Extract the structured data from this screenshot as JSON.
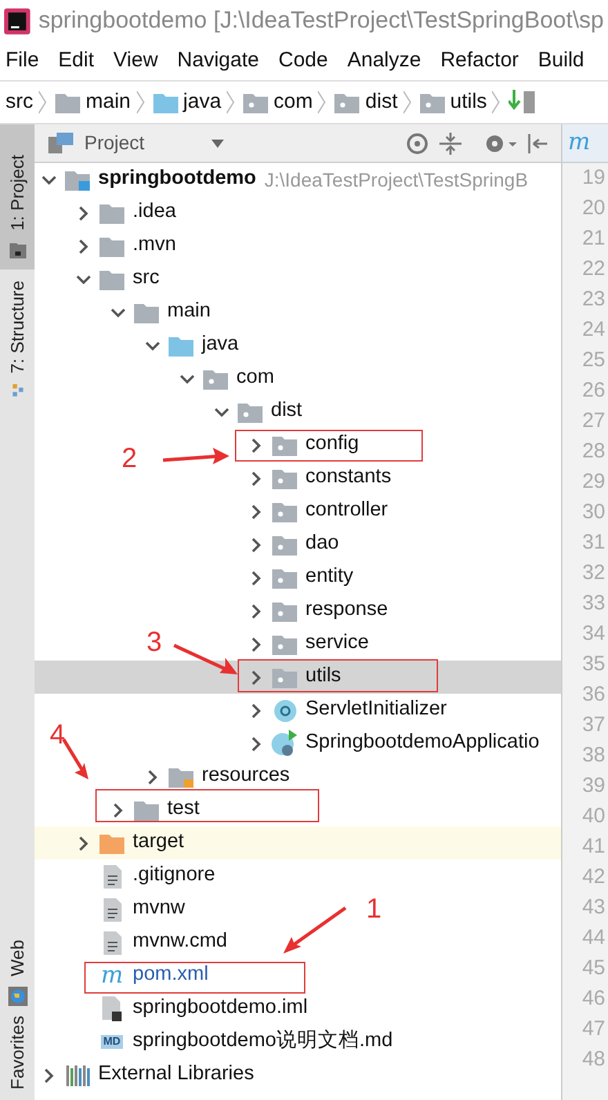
{
  "window": {
    "title": "springbootdemo [J:\\IdeaTestProject\\TestSpringBoot\\sp"
  },
  "menu": [
    "File",
    "Edit",
    "View",
    "Navigate",
    "Code",
    "Analyze",
    "Refactor",
    "Build"
  ],
  "breadcrumb": [
    {
      "label": "src",
      "kind": "plain"
    },
    {
      "label": "main",
      "kind": "folder"
    },
    {
      "label": "java",
      "kind": "source"
    },
    {
      "label": "com",
      "kind": "package"
    },
    {
      "label": "dist",
      "kind": "package"
    },
    {
      "label": "utils",
      "kind": "package"
    }
  ],
  "side_tabs": [
    {
      "label": "1: Project",
      "selected": true,
      "kind": "project"
    },
    {
      "label": "7: Structure",
      "selected": false,
      "kind": "structure"
    },
    {
      "label": "Web",
      "selected": false,
      "kind": "web"
    },
    {
      "label": "Favorites",
      "selected": false,
      "kind": "favorites"
    }
  ],
  "panel": {
    "title": "Project"
  },
  "editor_tab": {
    "icon": "m"
  },
  "tree": [
    {
      "name": "springbootdemo",
      "kind": "module",
      "path": "J:\\IdeaTestProject\\TestSpringB",
      "expanded": true,
      "selected": false,
      "children": [
        {
          "name": ".idea",
          "kind": "folder",
          "expanded": false,
          "selected": false
        },
        {
          "name": ".mvn",
          "kind": "folder",
          "expanded": false,
          "selected": false
        },
        {
          "name": "src",
          "kind": "folder",
          "expanded": true,
          "selected": false,
          "children": [
            {
              "name": "main",
              "kind": "folder",
              "expanded": true,
              "selected": false,
              "children": [
                {
                  "name": "java",
                  "kind": "source",
                  "expanded": true,
                  "selected": false,
                  "children": [
                    {
                      "name": "com",
                      "kind": "package",
                      "expanded": true,
                      "selected": false,
                      "children": [
                        {
                          "name": "dist",
                          "kind": "package",
                          "expanded": true,
                          "selected": false,
                          "children": [
                            {
                              "name": "config",
                              "kind": "package",
                              "expanded": false,
                              "selected": false
                            },
                            {
                              "name": "constants",
                              "kind": "package",
                              "expanded": false,
                              "selected": false
                            },
                            {
                              "name": "controller",
                              "kind": "package",
                              "expanded": false,
                              "selected": false
                            },
                            {
                              "name": "dao",
                              "kind": "package",
                              "expanded": false,
                              "selected": false
                            },
                            {
                              "name": "entity",
                              "kind": "package",
                              "expanded": false,
                              "selected": false
                            },
                            {
                              "name": "response",
                              "kind": "package",
                              "expanded": false,
                              "selected": false
                            },
                            {
                              "name": "service",
                              "kind": "package",
                              "expanded": false,
                              "selected": false
                            },
                            {
                              "name": "utils",
                              "kind": "package",
                              "expanded": false,
                              "selected": true
                            },
                            {
                              "name": "ServletInitializer",
                              "kind": "class",
                              "expanded": false,
                              "selected": false
                            },
                            {
                              "name": "SpringbootdemoApplicatio",
                              "kind": "app",
                              "expanded": false,
                              "selected": false
                            }
                          ]
                        }
                      ]
                    }
                  ]
                },
                {
                  "name": "resources",
                  "kind": "resources",
                  "expanded": false,
                  "selected": false
                }
              ]
            },
            {
              "name": "test",
              "kind": "folder",
              "expanded": false,
              "selected": false
            }
          ]
        },
        {
          "name": "target",
          "kind": "excluded",
          "expanded": false,
          "selected": false
        },
        {
          "name": ".gitignore",
          "kind": "file",
          "selected": false
        },
        {
          "name": "mvnw",
          "kind": "file",
          "selected": false
        },
        {
          "name": "mvnw.cmd",
          "kind": "file",
          "selected": false
        },
        {
          "name": "pom.xml",
          "kind": "maven",
          "icon": "m",
          "selected": false
        },
        {
          "name": "springbootdemo.iml",
          "kind": "iml",
          "selected": false
        },
        {
          "name": "springbootdemo说明文档.md",
          "kind": "md",
          "icon": "MD",
          "selected": false
        }
      ]
    },
    {
      "name": "External Libraries",
      "kind": "libraries",
      "expanded": false,
      "selected": false
    }
  ],
  "gutter": {
    "line_numbers": [
      "19",
      "20",
      "21",
      "22",
      "23",
      "24",
      "25",
      "26",
      "27",
      "28",
      "29",
      "30",
      "31",
      "32",
      "33",
      "34",
      "35",
      "36",
      "37",
      "38",
      "39",
      "40",
      "41",
      "42",
      "43",
      "44",
      "45",
      "46",
      "47",
      "48"
    ]
  },
  "annotations": [
    {
      "label": "2"
    },
    {
      "label": "3"
    },
    {
      "label": "4"
    },
    {
      "label": "1"
    }
  ]
}
